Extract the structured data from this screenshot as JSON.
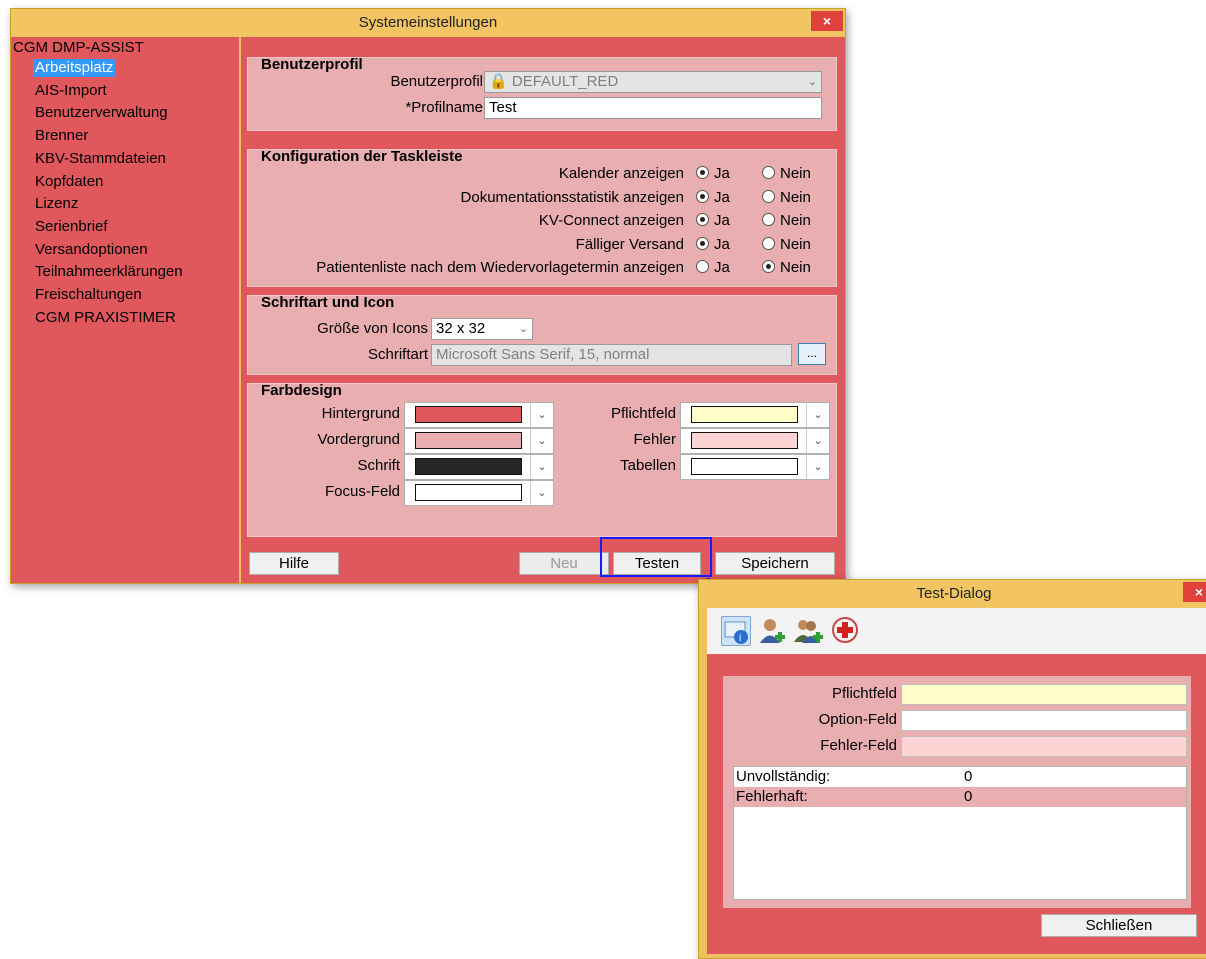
{
  "main": {
    "title": "Systemeinstellungen",
    "close": "×",
    "tree": {
      "root": "CGM DMP-ASSIST",
      "items": [
        "Arbeitsplatz",
        "AIS-Import",
        "Benutzerverwaltung",
        "Brenner",
        "KBV-Stammdateien",
        "Kopfdaten",
        "Lizenz",
        "Serienbrief",
        "Versandoptionen",
        "Teilnahmeerklärungen",
        "Freischaltungen",
        "CGM PRAXISTIMER"
      ],
      "selected": "Arbeitsplatz"
    },
    "profile": {
      "title": "Benutzerprofil",
      "profile_label": "Benutzerprofil",
      "profile_value": "DEFAULT_RED",
      "name_label": "*Profilname",
      "name_value": "Test"
    },
    "taskbar": {
      "title": "Konfiguration der Taskleiste",
      "yes": "Ja",
      "no": "Nein",
      "rows": [
        {
          "label": "Kalender anzeigen",
          "value": "Ja"
        },
        {
          "label": "Dokumentationsstatistik anzeigen",
          "value": "Ja"
        },
        {
          "label": "KV-Connect anzeigen",
          "value": "Ja"
        },
        {
          "label": "Fälliger Versand",
          "value": "Ja"
        },
        {
          "label": "Patientenliste nach dem Wiedervorlagetermin anzeigen",
          "value": "Nein"
        }
      ]
    },
    "font": {
      "title": "Schriftart und Icon",
      "iconsize_label": "Größe von Icons",
      "iconsize_value": "32 x 32",
      "font_label": "Schriftart",
      "font_value": "Microsoft Sans Serif, 15, normal",
      "browse": "..."
    },
    "colors": {
      "title": "Farbdesign",
      "items": [
        {
          "label": "Hintergrund",
          "color": "#e0585b"
        },
        {
          "label": "Vordergrund",
          "color": "#e8aeb0"
        },
        {
          "label": "Schrift",
          "color": "#262626"
        },
        {
          "label": "Focus-Feld",
          "color": "#ffffff"
        },
        {
          "label": "Pflichtfeld",
          "color": "#fffdc8"
        },
        {
          "label": "Fehler",
          "color": "#fdd4d4"
        },
        {
          "label": "Tabellen",
          "color": "#ffffff"
        }
      ]
    },
    "buttons": {
      "help": "Hilfe",
      "new": "Neu",
      "test": "Testen",
      "save": "Speichern"
    }
  },
  "dialog": {
    "title": "Test-Dialog",
    "close": "×",
    "toolbar_icons": [
      "info-card-icon",
      "add-user-icon",
      "add-users-icon",
      "medical-cross-icon"
    ],
    "fields": [
      {
        "label": "Pflichtfeld",
        "color": "#fffdc8"
      },
      {
        "label": "Option-Feld",
        "color": "#ffffff"
      },
      {
        "label": "Fehler-Feld",
        "color": "#fdd4d4"
      }
    ],
    "list": [
      {
        "label": "Unvollständig:",
        "value": "0"
      },
      {
        "label": "Fehlerhaft:",
        "value": "0"
      }
    ],
    "close_button": "Schließen"
  }
}
